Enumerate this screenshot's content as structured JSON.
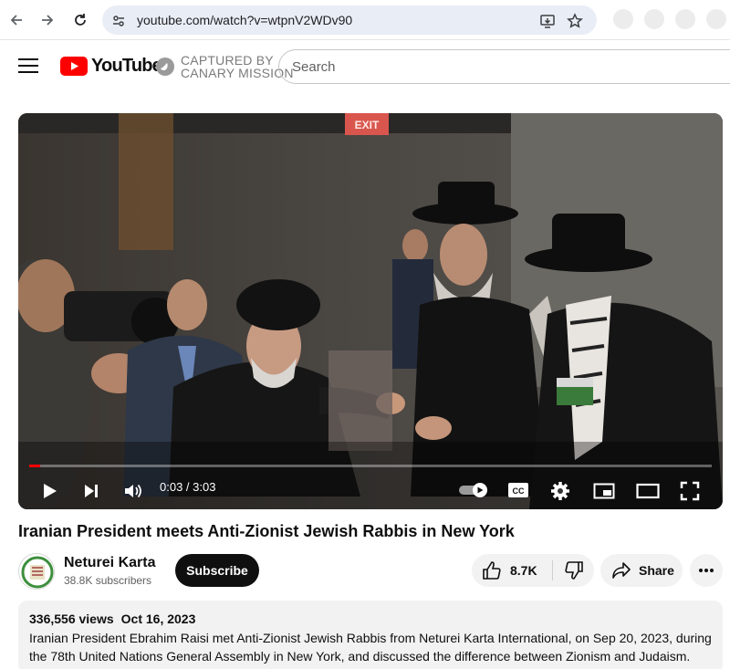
{
  "browser": {
    "url": "youtube.com/watch?v=wtpnV2WDv90"
  },
  "header": {
    "logo_text": "YouTube",
    "extension_line1": "CAPTURED BY",
    "extension_line2": "CANARY MISSION",
    "search_placeholder": "Search"
  },
  "player": {
    "current_time": "0:03",
    "duration": "3:03",
    "time_display": "0:03 / 3:03",
    "progress_fraction": 0.016,
    "sign_text": "EXIT"
  },
  "video": {
    "title": "Iranian President meets Anti-Zionist Jewish Rabbis in New York"
  },
  "channel": {
    "name": "Neturei Karta",
    "subscribers": "38.8K subscribers",
    "subscribe_label": "Subscribe"
  },
  "actions": {
    "like_count": "8.7K",
    "share_label": "Share"
  },
  "description": {
    "views": "336,556 views",
    "date": "Oct 16, 2023",
    "text": "Iranian President Ebrahim Raisi met Anti-Zionist Jewish Rabbis from Neturei Karta International, on Sep 20, 2023, during the 78th United Nations General Assembly in New York, and discussed the difference between Zionism and Judaism."
  },
  "colors": {
    "brand_red": "#ff0000",
    "text_primary": "#0f0f0f",
    "text_secondary": "#606060",
    "chip_bg": "#f2f2f2"
  }
}
